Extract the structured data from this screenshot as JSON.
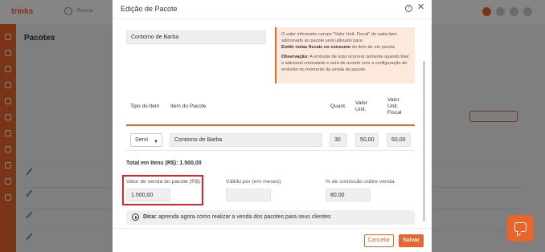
{
  "background": {
    "logo": "trinks",
    "search_label": "Busca",
    "page_title": "Pacotes"
  },
  "modal": {
    "title": "Edição de Pacote",
    "package_name": "Contorno de Barba",
    "info": {
      "line1": "O valor informado campo \"Valor Unit. Fiscal\" de cada item adicionado ao pacote será utilizado para:",
      "bold_part": "Emitir notas fiscais no consumo",
      "line1_end": " do item de um pacote",
      "obs_label": "Observação:",
      "obs_text": " A emissão de nota ocorrerá somente quando tiver o adicional contratado e será de acordo com a configuração de emissão no momento da venda do pacote."
    },
    "table": {
      "headers": {
        "tipo": "Tipo do Item",
        "item": "Item do Pacote",
        "quant": "Quant.",
        "valor_unit_line1": "Valor",
        "valor_unit_line2": "Unit.",
        "fiscal_line1": "Valor",
        "fiscal_line2": "Unit.",
        "fiscal_line3": "Fiscal"
      },
      "row": {
        "tipo": "Servi",
        "item": "Contorno de Barba",
        "quant": "30",
        "valor_unit": "50,00",
        "fiscal": "50,00"
      }
    },
    "total_label": "Total em Itens (R$): 1.500,00",
    "sale_value_label": "Valor de venda do pacote (R$):",
    "sale_value": "1.500,00",
    "valid_label": "Válido por (em meses)",
    "valid_value": "",
    "commission_label": "% de comissão sobre venda",
    "commission_value": "80,00",
    "dica_label": "Dica:",
    "dica_text": " aprenda agora como realizar a venda dos pacotes para seus clientes",
    "cancel_label": "Cancelar",
    "save_label": "Salvar"
  },
  "colors": {
    "accent": "#e8662b",
    "highlight": "#d8262b",
    "info_bg": "#fde8dc"
  }
}
